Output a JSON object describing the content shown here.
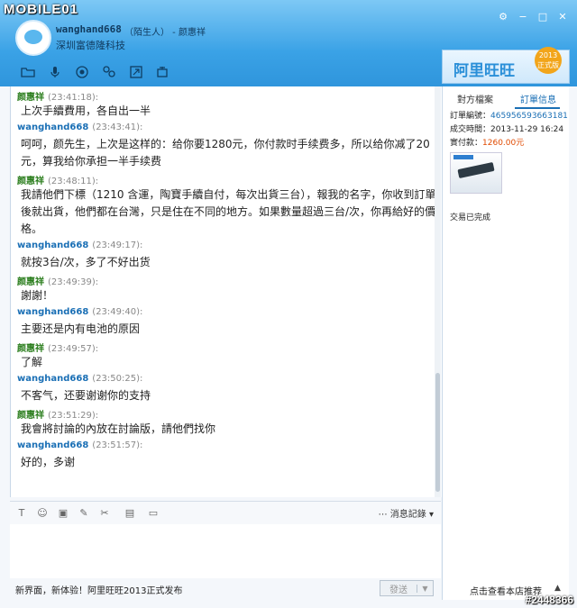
{
  "watermark": {
    "top": "MOBILE01",
    "bottom": "#2448366"
  },
  "contact": {
    "name": "wanghand668",
    "role": "（陌生人） - 颜惠祥",
    "company": "深圳富德隆科技"
  },
  "window_controls": {
    "settings": "⚙",
    "minimize": "−",
    "maximize": "□",
    "close": "✕"
  },
  "toolbar_icons": [
    "folder-icon",
    "microphone-icon",
    "camera-icon",
    "people-icon",
    "share-icon",
    "translate-icon"
  ],
  "banner": {
    "text": "阿里旺旺",
    "badge_year": "2013",
    "badge_edition": "正式版"
  },
  "messages": [
    {
      "sender": "颜惠祥",
      "time": "(23:41:18):",
      "text": "上次手續費用，各自出一半",
      "color": "green"
    },
    {
      "sender": "wanghand668",
      "time": "(23:43:41):",
      "text": "呵呵，颜先生，上次是这样的：给你要1280元，你付款时手续费多，所以给你减了20元，算我给你承担一半手续费",
      "color": "blue"
    },
    {
      "sender": "颜惠祥",
      "time": "(23:48:11):",
      "text": "我請他們下標（1210 含運，陶寶手續自付，每次出貨三台），報我的名字，你收到訂單後就出貨，他們都在台灣，只是住在不同的地方。如果數量超過三台/次，你再給好的價格。",
      "color": "green"
    },
    {
      "sender": "wanghand668",
      "time": "(23:49:17):",
      "text": "就按3台/次，多了不好出货",
      "color": "blue"
    },
    {
      "sender": "颜惠祥",
      "time": "(23:49:39):",
      "text": "謝謝！",
      "color": "green"
    },
    {
      "sender": "wanghand668",
      "time": "(23:49:40):",
      "text": "主要还是内有电池的原因",
      "color": "blue"
    },
    {
      "sender": "颜惠祥",
      "time": "(23:49:57):",
      "text": "了解",
      "color": "green"
    },
    {
      "sender": "wanghand668",
      "time": "(23:50:25):",
      "text": "不客气，还要谢谢你的支持",
      "color": "blue"
    },
    {
      "sender": "颜惠祥",
      "time": "(23:51:29):",
      "text": "我會將討論的內放在討論版，請他們找你",
      "color": "green"
    },
    {
      "sender": "wanghand668",
      "time": "(23:51:57):",
      "text": "好的，多谢",
      "color": "blue"
    }
  ],
  "input_toolbar": {
    "history_label": "消息記錄"
  },
  "bottombar": {
    "news": "新界面，新体验！阿里旺旺2013正式发布",
    "send_label": "發送",
    "send_arrow": "▼"
  },
  "side": {
    "tab_other_file": "對方檔案",
    "tab_order_info": "訂單信息",
    "order_no_label": "訂單編號：",
    "order_no": "465956593663181",
    "deal_time_label": "成交時間：",
    "deal_time": "2013-11-29 16:24",
    "paid_label": "實付款：",
    "paid": "1260.00元",
    "status": "交易已完成",
    "bottom_link": "点击查看本店推荐",
    "bottom_arrow": "▲"
  }
}
